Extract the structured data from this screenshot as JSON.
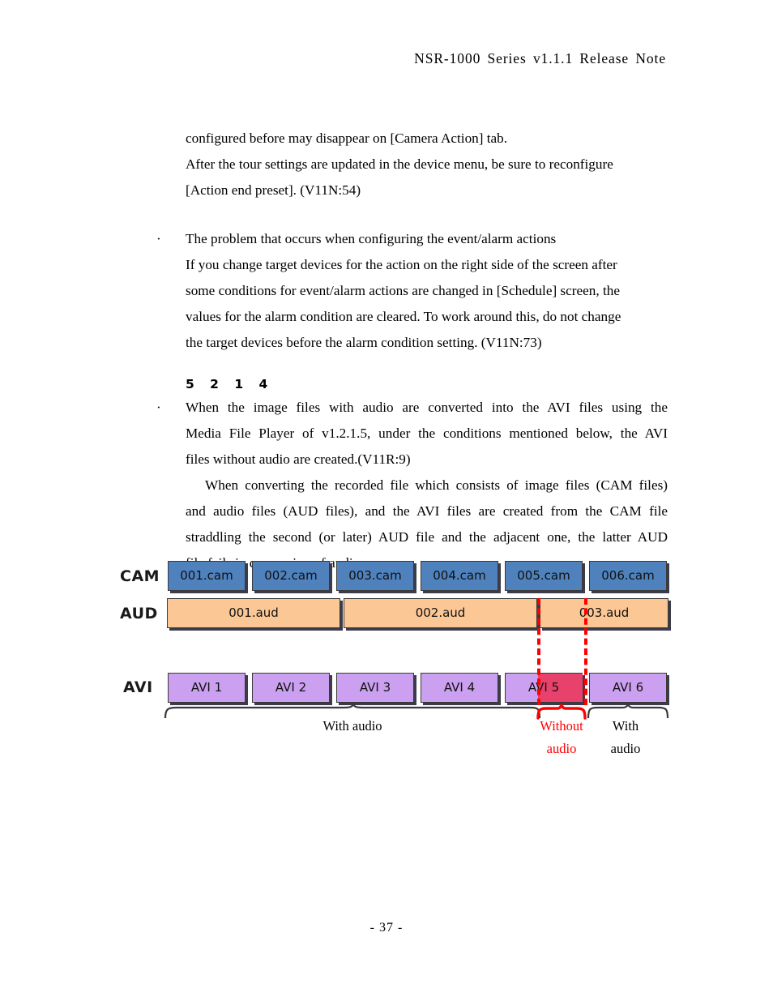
{
  "header": {
    "title": "NSR-1000  Series  v1.1.1  Release  Note"
  },
  "body": {
    "para_top": {
      "line1": "configured before may disappear on [Camera Action] tab.",
      "line2": "After the tour settings are updated in the device menu, be sure to reconfigure",
      "line3": "[Action end preset]. (V11N:54)"
    },
    "bullet_1": {
      "marker": "·",
      "line1": "The problem that occurs when configuring the event/alarm actions",
      "line2": "If you change target devices for the action on the right side of the screen after",
      "line3": "some conditions for event/alarm actions are changed in [Schedule] screen, the",
      "line4": "values for the alarm condition are cleared. To work around this, do not change",
      "line5": "the target devices before the alarm condition setting. (V11N:73)"
    },
    "section_number": "5 2 1 4",
    "bullet_2": {
      "marker": "·",
      "line1": "When the image files with audio are converted into the AVI files using the",
      "line2": "Media File Player of v1.2.1.5, under the conditions mentioned below, the AVI",
      "line3": "files without audio are created.(V11R:9)",
      "line4": "When converting the recorded file which consists of image files (CAM files)",
      "line5": "and audio files (AUD files), and the AVI files are created from the CAM file",
      "line6": "straddling the second (or later) AUD file and the adjacent one, the latter AUD",
      "line7": "file fails in conversion of audio."
    }
  },
  "diagram": {
    "row_labels": {
      "cam": "CAM",
      "aud": "AUD",
      "avi": "AVI"
    },
    "cam_files": [
      "001.cam",
      "002.cam",
      "003.cam",
      "004.cam",
      "005.cam",
      "006.cam"
    ],
    "aud_files": [
      "001.aud",
      "002.aud",
      "003.aud"
    ],
    "avi_files": [
      "AVI 1",
      "AVI 2",
      "AVI 3",
      "AVI 4",
      "AVI 5",
      "AVI 6"
    ],
    "captions": {
      "with_audio_left": "With audio",
      "without_audio": "Without\naudio",
      "without_audio_l1": "Without",
      "without_audio_l2": "audio",
      "with_audio_right_l1": "With",
      "with_audio_right_l2": "audio"
    },
    "colors": {
      "cam_fill": "#4F81BD",
      "aud_fill": "#FBC795",
      "avi_fill": "#CBA0F0",
      "highlight_fill": "#E8416B",
      "marker_line": "#FF0000",
      "brace_stroke": "#3A3A3A"
    }
  },
  "footer": {
    "page_number": "- 37 -"
  }
}
